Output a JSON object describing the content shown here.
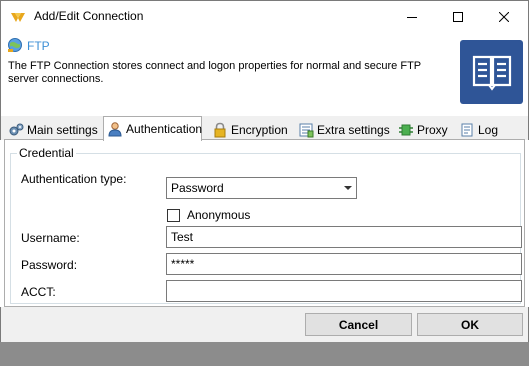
{
  "window": {
    "title": "Add/Edit Connection"
  },
  "header": {
    "title": "FTP",
    "description": "The FTP Connection stores connect and logon properties for normal and secure FTP server connections."
  },
  "tabs": [
    {
      "label": "Main settings",
      "icon": "gears-icon"
    },
    {
      "label": "Authentication",
      "icon": "user-icon",
      "active": true
    },
    {
      "label": "Encryption",
      "icon": "lock-icon"
    },
    {
      "label": "Extra settings",
      "icon": "settings-list-icon"
    },
    {
      "label": "Proxy",
      "icon": "proxy-icon"
    },
    {
      "label": "Log",
      "icon": "log-icon"
    }
  ],
  "credential": {
    "legend": "Credential",
    "auth_type_label": "Authentication type:",
    "auth_type_value": "Password",
    "anonymous_label": "Anonymous",
    "anonymous_checked": false,
    "username_label": "Username:",
    "username_value": "Test",
    "password_label": "Password:",
    "password_value": "*****",
    "acct_label": "ACCT:",
    "acct_value": ""
  },
  "buttons": {
    "cancel": "Cancel",
    "ok": "OK"
  },
  "colors": {
    "accent": "#3c8fd6",
    "badge": "#2f5597"
  }
}
